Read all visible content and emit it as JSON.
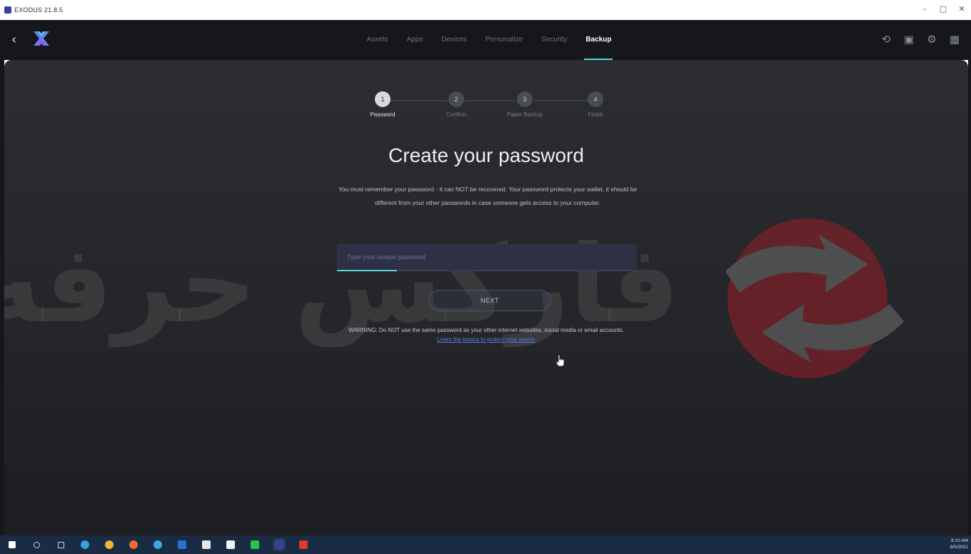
{
  "window": {
    "title": "EXODUS 21.8.5",
    "controls": [
      "–",
      "□",
      "✕"
    ]
  },
  "nav": {
    "back_icon": "‹",
    "tabs": [
      {
        "label": "Assets",
        "active": false
      },
      {
        "label": "Apps",
        "active": false
      },
      {
        "label": "Devices",
        "active": false
      },
      {
        "label": "Personalize",
        "active": false
      },
      {
        "label": "Security",
        "active": false
      },
      {
        "label": "Backup",
        "active": true
      }
    ],
    "right_icons": [
      {
        "name": "history-icon",
        "glyph": "⟲"
      },
      {
        "name": "chip-icon",
        "glyph": "▣"
      },
      {
        "name": "settings-icon",
        "glyph": "⚙"
      },
      {
        "name": "grid-icon",
        "glyph": "▦"
      }
    ],
    "accent_color": "#5bd3d8"
  },
  "stepper": {
    "steps": [
      {
        "number": "1",
        "label": "Password",
        "active": true
      },
      {
        "number": "2",
        "label": "Confirm",
        "active": false
      },
      {
        "number": "3",
        "label": "Paper Backup",
        "active": false
      },
      {
        "number": "4",
        "label": "Finish",
        "active": false
      }
    ]
  },
  "main": {
    "heading": "Create your password",
    "description": "You must remember your password - it can NOT be recovered. Your password protects your wallet, it should be different from your other passwords in case someone gets access to your computer.",
    "password_placeholder": "Type your unique password",
    "password_value": "",
    "strength_fraction": 0.2,
    "next_label": "NEXT",
    "warning": "WARNING: Do NOT use the same password as your other internet websites, social media or email accounts.",
    "learn_link": "Learn the basics to protect your assets"
  },
  "watermark": {
    "text": "فارکس حرفه‌ای",
    "logo_color": "#8e1f28"
  },
  "taskbar": {
    "items": [
      {
        "name": "start-icon",
        "color": "#ffffff"
      },
      {
        "name": "search-icon",
        "color": "#c8d3e6"
      },
      {
        "name": "task-view-icon",
        "color": "#c8d3e6"
      },
      {
        "name": "edge-icon",
        "color": "#2fa7d8"
      },
      {
        "name": "chrome-icon",
        "color": "#f2b632"
      },
      {
        "name": "firefox-icon",
        "color": "#f26b2a"
      },
      {
        "name": "telegram-icon",
        "color": "#3aa8e0"
      },
      {
        "name": "outlook-icon",
        "color": "#2a6fd6"
      },
      {
        "name": "store-icon",
        "color": "#e6e6e6"
      },
      {
        "name": "app-icon-white",
        "color": "#f2f2f2"
      },
      {
        "name": "app-icon-green",
        "color": "#29c14a"
      },
      {
        "name": "exodus-taskbar-icon",
        "color": "#3c3f98"
      },
      {
        "name": "app-icon-red",
        "color": "#e03a2a"
      }
    ],
    "clock_time": "8:10 AM",
    "clock_date": "8/5/2021"
  }
}
